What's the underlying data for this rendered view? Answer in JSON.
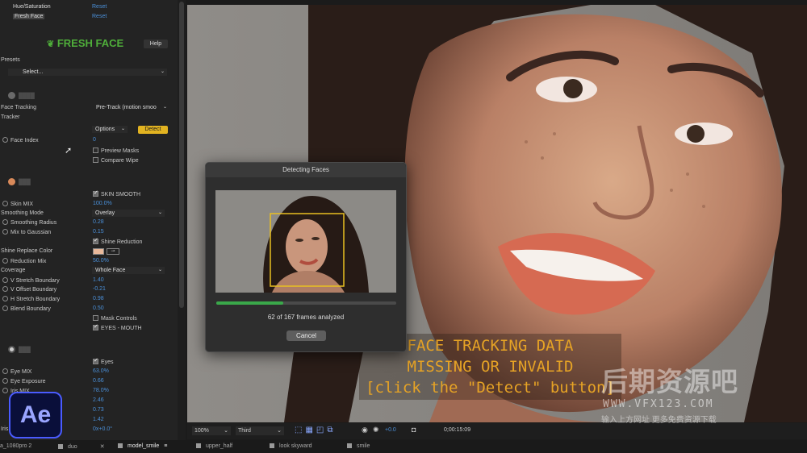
{
  "effects": {
    "hue_saturation": {
      "name": "Hue/Saturation",
      "reset": "Reset"
    },
    "fresh_face": {
      "name": "Fresh Face",
      "reset": "Reset"
    }
  },
  "plugin": {
    "logo_text": "FRESH FACE",
    "help": "Help",
    "accent": "#4fae3a"
  },
  "presets": {
    "label": "Presets",
    "value": "Select..."
  },
  "tracking": {
    "face_tracking_label": "Face Tracking",
    "tracker_label": "Tracker",
    "tracker_value": "Pre-Track (motion smoo",
    "options": "Options",
    "detect": "Detect",
    "face_index_label": "Face Index",
    "face_index_value": "0",
    "preview_masks": "Preview Masks",
    "compare_wipe": "Compare Wipe"
  },
  "skin": {
    "skin_smooth": "SKIN SMOOTH",
    "skin_mix_label": "Skin MIX",
    "skin_mix_value": "100.0%",
    "smoothing_mode_label": "Smoothing Mode",
    "smoothing_mode_value": "Overlay",
    "smoothing_radius_label": "Smoothing Radius",
    "smoothing_radius_value": "0.28",
    "mix_to_gaussian_label": "Mix to Gaussian",
    "mix_to_gaussian_value": "0.15",
    "shine_reduction": "Shine Reduction",
    "shine_replace_color_label": "Shine Replace Color",
    "shine_color": "#e8b89a",
    "reduction_mix_label": "Reduction Mix",
    "reduction_mix_value": "50.0%",
    "coverage_label": "Coverage",
    "coverage_value": "Whole Face",
    "v_stretch_label": "V Stretch Boundary",
    "v_stretch_value": "1.40",
    "v_offset_label": "V Offset Boundary",
    "v_offset_value": "-0.21",
    "h_stretch_label": "H Stretch Boundary",
    "h_stretch_value": "0.98",
    "blend_label": "Blend Boundary",
    "blend_value": "0.50",
    "mask_controls": "Mask Controls",
    "eyes_mouth": "EYES - MOUTH"
  },
  "eyes": {
    "eyes_check": "Eyes",
    "eye_mix_label": "Eye MIX",
    "eye_mix_value": "63.0%",
    "eye_exposure_label": "Eye Exposure",
    "eye_exposure_value": "0.66",
    "iris_mix_label": "Iris MIX",
    "iris_mix_value": "78.0%",
    "row4_value": "2.46",
    "row5_value": "0.73",
    "row6_value": "1.42",
    "iris_label": "Iris",
    "iris_value": "0x+0.0°"
  },
  "dialog": {
    "title": "Detecting Faces",
    "progress": 0.371,
    "frames_text": "62 of 167 frames analyzed",
    "cancel": "Cancel"
  },
  "overlay": {
    "line1": "FACE TRACKING DATA",
    "line2": "MISSING OR INVALID",
    "line3": "[click the \"Detect\" button]"
  },
  "watermark": {
    "line1": "后期资源吧",
    "line2": "WWW.VFX123.COM",
    "line3": "输入上方网址 更多免费资源下载"
  },
  "viewer_bar": {
    "zoom": "100%",
    "resolution": "Third",
    "exposure": "+0.0",
    "timecode": "0;00:15:09"
  },
  "timeline_tabs": [
    "a_1080pro 2",
    "duo",
    "model_smile",
    "upper_half",
    "look skyward",
    "smile"
  ],
  "app_logo": "Ae"
}
